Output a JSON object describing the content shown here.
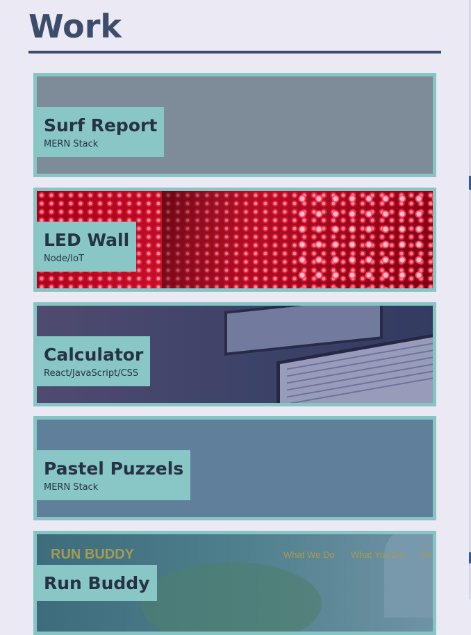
{
  "section": {
    "title": "Work"
  },
  "projects": [
    {
      "title": "Surf Report",
      "stack": "MERN Stack"
    },
    {
      "title": "LED Wall",
      "stack": "Node/IoT"
    },
    {
      "title": "Calculator",
      "stack": "React/JavaScript/CSS"
    },
    {
      "title": "Pastel Puzzels",
      "stack": "MERN Stack"
    },
    {
      "title": "Run Buddy",
      "stack": ""
    }
  ],
  "run_buddy_preview": {
    "brand": "RUN BUDDY",
    "nav": [
      "What We Do",
      "What You Do",
      "Yo"
    ]
  },
  "colors": {
    "heading": "#3c4d6b",
    "card_border": "#87c5c5",
    "label_bg": "#89c6c6",
    "page_bg": "#eae9f4"
  }
}
